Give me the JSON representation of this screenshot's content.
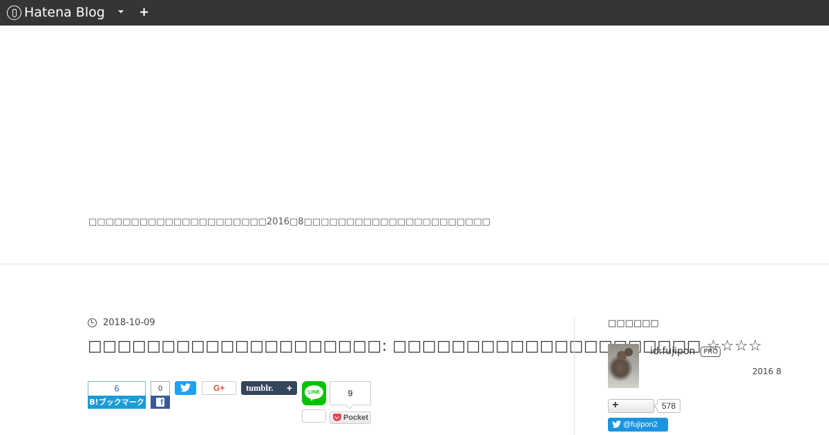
{
  "topbar": {
    "logo_text": "Hatena Blog",
    "add_label": "+"
  },
  "blog": {
    "description": "□□□□□□□□□□□□□□□□□□□□□2016□8□□□□□□□□□□□□□□□□□□□□□□"
  },
  "article": {
    "date": "2018-10-09",
    "title": "□□□□□□□□□□□□□□□□□□□□: □□□□□□□□□□□□□□□□□□□□□ ☆☆☆☆"
  },
  "share": {
    "hatena_count": "6",
    "hatena_label": "B!ブックマーク",
    "facebook_count": "0",
    "facebook_icon": "f",
    "googleplus_label": "G+",
    "tumblr_label": "tumblr.",
    "tumblr_plus": "+",
    "line_label": "LINE",
    "pocket_count": "9",
    "pocket_label": "Pocket"
  },
  "sidebar": {
    "heading": "□□□□□□",
    "user_id": "id:fujipon",
    "pro_badge": "PRO",
    "since": "2016  8",
    "follow_plus": "+",
    "follow_count": "578",
    "twitter_handle": "@fujipon2"
  },
  "colors": {
    "topbar": "#353535",
    "hatena_blue": "#1c9bd6",
    "facebook": "#3b5998",
    "twitter": "#1da1f2",
    "tumblr": "#35465c",
    "line": "#00c300",
    "pocket": "#ee4056"
  }
}
